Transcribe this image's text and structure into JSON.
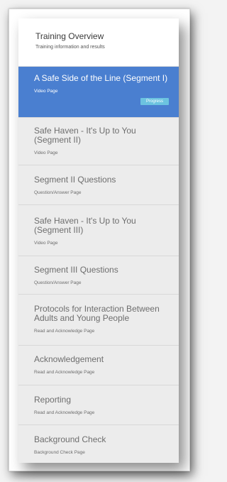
{
  "overview": {
    "title": "Training Overview",
    "subtitle": "Training information and results"
  },
  "items": [
    {
      "title": "A Safe Side of the Line (Segment I)",
      "type": "Video Page",
      "badge": "Progress"
    },
    {
      "title": "Safe Haven - It's Up to You (Segment II)",
      "type": "Video Page"
    },
    {
      "title": "Segment II Questions",
      "type": "Question/Answer Page"
    },
    {
      "title": "Safe Haven - It's Up to You (Segment III)",
      "type": "Video Page"
    },
    {
      "title": "Segment III Questions",
      "type": "Question/Answer Page"
    },
    {
      "title": "Protocols for Interaction Between Adults and Young People",
      "type": "Read and Acknowledge Page"
    },
    {
      "title": "Acknowledgement",
      "type": "Read and Acknowledge Page"
    },
    {
      "title": "Reporting",
      "type": "Read and Acknowledge Page"
    },
    {
      "title": "Background Check",
      "type": "Background Check Page"
    }
  ],
  "colors": {
    "active": "#4a7fd0",
    "badge": "#6cc3e0"
  }
}
